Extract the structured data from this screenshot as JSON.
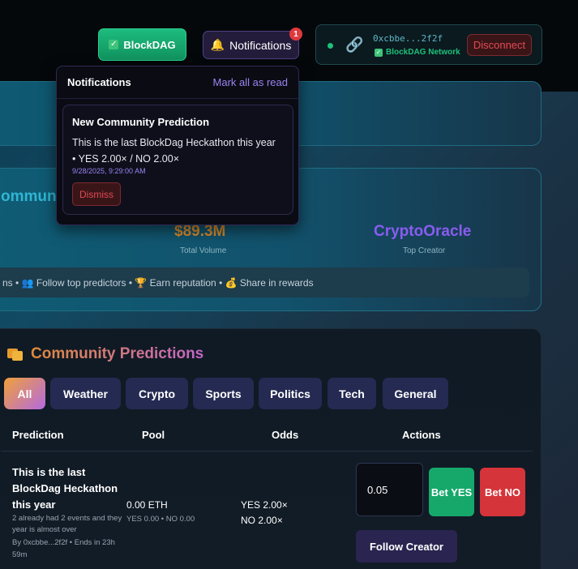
{
  "header": {
    "brand_label": "BlockDAG",
    "notifications_label": "Notifications",
    "notification_count": "1",
    "wallet": {
      "address": "0xcbbe...2f2f",
      "network": "BlockDAG Network",
      "disconnect_label": "Disconnect"
    }
  },
  "notifications": {
    "title": "Notifications",
    "mark_all_label": "Mark all as read",
    "items": [
      {
        "title": "New Community Prediction",
        "line1": "This is the last BlockDag Heckathon this year",
        "line2": "• YES 2.00× / NO 2.00×",
        "time": "9/28/2025, 9:29:00 AM",
        "dismiss_label": "Dismiss"
      }
    ]
  },
  "stats": {
    "title_fragment": "ommun",
    "total_volume_value": "$89.3M",
    "total_volume_label": "Total Volume",
    "top_creator_value": "CryptoOracle",
    "top_creator_label": "Top Creator",
    "tips": "ns • 👥 Follow top predictors • 🏆 Earn reputation • 💰 Share in rewards"
  },
  "community": {
    "title": "Community Predictions",
    "tabs": [
      "All",
      "Weather",
      "Crypto",
      "Sports",
      "Politics",
      "Tech",
      "General"
    ],
    "active_tab": "All",
    "columns": [
      "Prediction",
      "Pool",
      "Odds",
      "Actions"
    ],
    "rows": [
      {
        "title": "This is the last BlockDag Heckathon this year",
        "description": "2 already had 2 events and they year is almost over",
        "meta": "By 0xcbbe...2f2f • Ends in 23h 59m",
        "pool": "0.00 ETH",
        "pool_breakdown": "YES 0.00 • NO 0.00",
        "odds_yes": "YES 2.00×",
        "odds_no": "NO 2.00×",
        "bet_amount": "0.05",
        "bet_yes_label": "Bet YES",
        "bet_no_label": "Bet NO",
        "follow_label": "Follow Creator"
      }
    ]
  },
  "colors": {
    "accent_green": "#16a86b",
    "accent_red": "#d4343a",
    "accent_purple": "#9b84f0",
    "volume_orange": "#d98b2b",
    "creator_purple": "#8a5cf0"
  }
}
